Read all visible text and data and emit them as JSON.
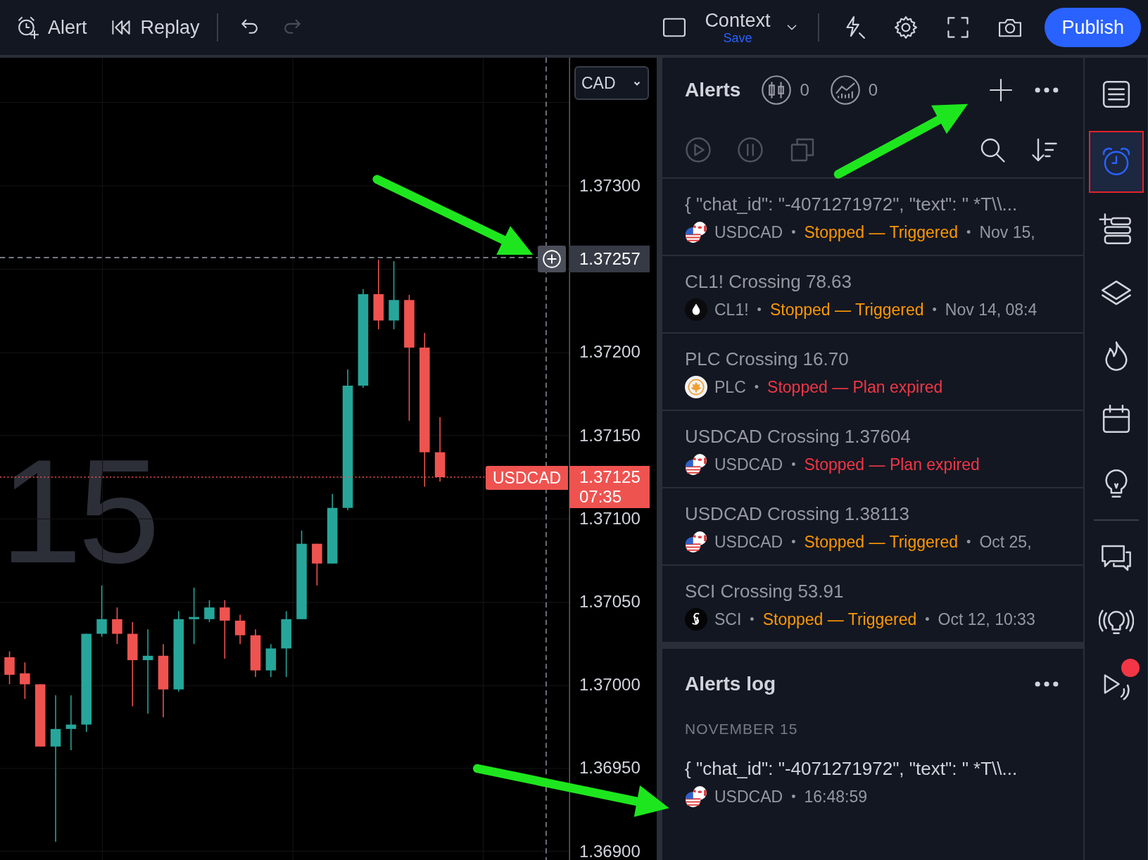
{
  "toolbar": {
    "left": [
      {
        "kind": "alert",
        "label": "Alert",
        "disabled": false
      },
      {
        "kind": "replay",
        "label": "Replay",
        "disabled": false
      },
      {
        "kind": "undo",
        "disabled": false
      },
      {
        "kind": "redo",
        "disabled": true
      }
    ],
    "layout": {
      "name": "Context",
      "status": "Save"
    },
    "right": [
      {
        "kind": "quick-search"
      },
      {
        "kind": "settings"
      },
      {
        "kind": "fullscreen"
      },
      {
        "kind": "snapshot"
      }
    ],
    "publish": "Publish"
  },
  "chart": {
    "watermark": {
      "interval": "15"
    },
    "currency": "CAD",
    "price_axis": [
      "1.37300",
      "1.37200",
      "1.37150",
      "1.37100",
      "1.37050",
      "1.37000",
      "1.36950",
      "1.36900"
    ],
    "crosshair_price": "1.37257",
    "symbol": "USDCAD",
    "last_price": "1.37125",
    "countdown": "07:35"
  },
  "alerts": {
    "title": "Alerts",
    "counters": [
      {
        "kind": "price",
        "count": "0"
      },
      {
        "kind": "indicator",
        "count": "0"
      }
    ],
    "actions": [
      {
        "kind": "play",
        "disabled": true
      },
      {
        "kind": "pause",
        "disabled": true
      },
      {
        "kind": "copy",
        "disabled": true
      },
      {
        "kind": "search",
        "disabled": false
      },
      {
        "kind": "sort",
        "disabled": false
      }
    ],
    "separator": "•",
    "items": [
      {
        "title": "{ \"chat_id\": \"-4071271972\", \"text\": \" *T\\\\...",
        "kind": "usdcad",
        "symbol": "USDCAD",
        "status": {
          "text": "Stopped — Triggered",
          "kind": "triggered"
        },
        "time": "Nov 15,"
      },
      {
        "title": "CL1! Crossing 78.63",
        "kind": "oil",
        "symbol": "CL1!",
        "status": {
          "text": "Stopped — Triggered",
          "kind": "triggered"
        },
        "time": "Nov 14, 08:4"
      },
      {
        "title": "PLC Crossing 16.70",
        "kind": "plc",
        "symbol": "PLC",
        "status": {
          "text": "Stopped — Plan expired",
          "kind": "expired"
        }
      },
      {
        "title": "USDCAD Crossing 1.37604",
        "kind": "usdcad",
        "symbol": "USDCAD",
        "status": {
          "text": "Stopped — Plan expired",
          "kind": "expired"
        }
      },
      {
        "title": "USDCAD Crossing 1.38113",
        "kind": "usdcad",
        "symbol": "USDCAD",
        "status": {
          "text": "Stopped — Triggered",
          "kind": "triggered"
        },
        "time": "Oct 25,"
      },
      {
        "title": "SCI Crossing 53.91",
        "kind": "sci",
        "symbol": "SCI",
        "status": {
          "text": "Stopped — Triggered",
          "kind": "triggered"
        },
        "time": "Oct 12, 10:33"
      }
    ]
  },
  "alerts_log": {
    "title": "Alerts log",
    "date": "NOVEMBER 15",
    "separator": "•",
    "entries": [
      {
        "title": "{ \"chat_id\": \"-4071271972\", \"text\": \" *T\\\\...",
        "kind": "usdcad",
        "symbol": "USDCAD",
        "time": "16:48:59"
      }
    ]
  },
  "sidebar": {
    "top": [
      {
        "kind": "watchlist",
        "selected": false,
        "notification": false
      },
      {
        "kind": "alerts",
        "selected": true,
        "notification": false
      },
      {
        "kind": "add-list",
        "selected": false,
        "notification": false
      },
      {
        "kind": "layers",
        "selected": false,
        "notification": false
      },
      {
        "kind": "hotlist",
        "selected": false,
        "notification": false
      },
      {
        "kind": "calendar",
        "selected": false,
        "notification": false
      },
      {
        "kind": "ideas",
        "selected": false,
        "notification": false
      }
    ],
    "bottom": [
      {
        "kind": "chat",
        "selected": false,
        "notification": false
      },
      {
        "kind": "streams",
        "selected": false,
        "notification": false
      },
      {
        "kind": "playback",
        "selected": false,
        "notification": true
      }
    ]
  }
}
